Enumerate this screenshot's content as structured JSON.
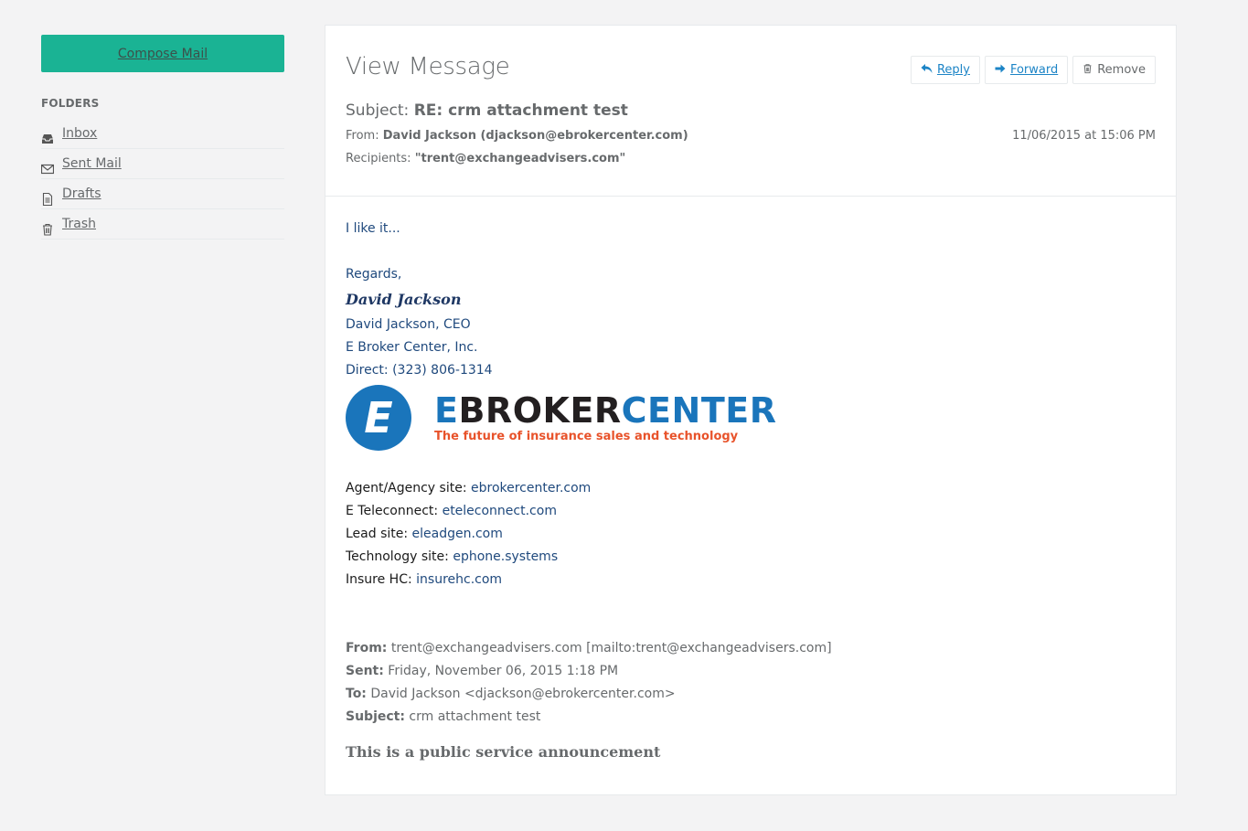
{
  "sidebar": {
    "compose_label": "Compose Mail",
    "folders_title": "FOLDERS",
    "folders": [
      {
        "label": "Inbox",
        "icon": "inbox-icon"
      },
      {
        "label": "Sent Mail",
        "icon": "envelope-icon"
      },
      {
        "label": "Drafts",
        "icon": "file-icon"
      },
      {
        "label": "Trash",
        "icon": "trash-icon"
      }
    ]
  },
  "message": {
    "view_title": "View Message",
    "actions": {
      "reply": "Reply",
      "forward": "Forward",
      "remove": "Remove"
    },
    "subject_label": "Subject:",
    "subject": "RE: crm attachment test",
    "from_label": "From:",
    "from": "David Jackson (djackson@ebrokercenter.com)",
    "date": "11/06/2015 at 15:06 PM",
    "recipients_label": "Recipients:",
    "recipients": "\"trent@exchangeadvisers.com\""
  },
  "body": {
    "greeting": "I like it...",
    "regards": "Regards,",
    "signature_script": "David Jackson",
    "sig_name": "David Jackson, CEO",
    "sig_company": "E Broker Center, Inc.",
    "sig_direct": "Direct: (323) 806-1314",
    "logo": {
      "letter": "E",
      "name_part1": "E",
      "name_part2": "BROKER",
      "name_part3": "CENTER",
      "tagline": "The future of insurance sales and technology"
    },
    "links": [
      {
        "label": "Agent/Agency site:",
        "url": "ebrokercenter.com"
      },
      {
        "label": "E Teleconnect:",
        "url": "eteleconnect.com"
      },
      {
        "label": "Lead site:",
        "url": "eleadgen.com"
      },
      {
        "label": "Technology site:",
        "url": "ephone.systems"
      },
      {
        "label": "Insure HC:",
        "url": "insurehc.com"
      }
    ],
    "quoted": {
      "from_label": "From:",
      "from": "trent@exchangeadvisers.com [mailto:trent@exchangeadvisers.com]",
      "sent_label": "Sent:",
      "sent": "Friday, November 06, 2015 1:18 PM",
      "to_label": "To:",
      "to": "David Jackson <djackson@ebrokercenter.com>",
      "subject_label": "Subject:",
      "subject": "crm attachment test"
    },
    "announcement": "This is a public service announcement"
  },
  "colors": {
    "accent": "#1ab394",
    "link": "#1c84c6",
    "signature": "#1f497d",
    "logo_blue": "#1a75bb",
    "logo_orange": "#e8532b"
  }
}
